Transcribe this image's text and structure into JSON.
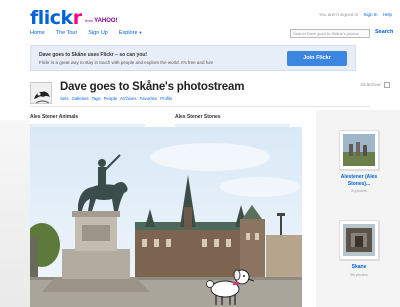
{
  "header": {
    "logo_main": "flickr",
    "logo_tagline": "YAHOO!",
    "nav": [
      "Home",
      "The Tour",
      "Sign Up",
      "Explore"
    ],
    "signin_prefix": "You aren't signed in",
    "signin_link": "Sign In",
    "help_link": "Help",
    "search_placeholder": "Search Dave goes to Skåne's photos",
    "search_button": "Search"
  },
  "notice": {
    "line1": "Dave goes to Skåne uses Flickr – so can you!",
    "line2": "Flickr is a great way to stay in touch with people and explore the world. It's free and fun!",
    "join_button": "Join Flickr"
  },
  "photostream": {
    "title": "Dave goes to Skåne's photostream",
    "links": [
      "Sets",
      "Galleries",
      "Tags",
      "People",
      "Archives",
      "Favorites",
      "Profile"
    ],
    "slideshow": "Slideshow"
  },
  "sets": {
    "headers": [
      "Ales Stener Animals",
      "Ales Stener Stones"
    ]
  },
  "sidebar": {
    "cards": [
      {
        "name": "Alestener (Ales Stones)...",
        "count": "8 photos"
      },
      {
        "name": "Skane",
        "count": "98 photos"
      }
    ]
  },
  "colors": {
    "flickr_blue": "#0063dc",
    "flickr_pink": "#ff0084",
    "join_button": "#3a86e0",
    "notice_bg": "#e8eef7"
  }
}
